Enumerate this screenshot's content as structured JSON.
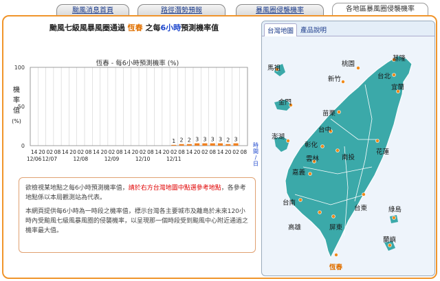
{
  "tabs": [
    {
      "label": "颱風消息首頁",
      "active": false
    },
    {
      "label": "路徑潛勢預報",
      "active": false
    },
    {
      "label": "暴風圈侵襲機率",
      "active": false
    },
    {
      "label": "各地區暴風圈侵襲機率",
      "active": true
    }
  ],
  "chart": {
    "title_prefix": "颱風七級風暴風圈通過",
    "title_station": "恆春",
    "title_mid": "之每",
    "title_hours": "6小時",
    "title_suffix": "預測機率值",
    "subtitle": "恆春 - 每6小時預測機率 (%)",
    "ylabel_chars": [
      "機",
      "率",
      "值",
      "(%)"
    ],
    "xunit_chars": [
      "時",
      "間",
      "/",
      "日"
    ]
  },
  "chart_data": {
    "type": "bar",
    "ylim": [
      0,
      100
    ],
    "yticks": [
      0,
      50,
      100
    ],
    "hour_labels": [
      "14",
      "20",
      "02",
      "08",
      "14",
      "20",
      "02",
      "08",
      "14",
      "20",
      "02",
      "08",
      "14",
      "20",
      "02",
      "08",
      "14",
      "20",
      "02",
      "08",
      "14",
      "20",
      "02",
      "08",
      "14",
      "20",
      "02",
      "08"
    ],
    "date_labels": [
      {
        "label": "12/06",
        "index": 0
      },
      {
        "label": "12/07",
        "index": 2
      },
      {
        "label": "12/08",
        "index": 6
      },
      {
        "label": "12/09",
        "index": 10
      },
      {
        "label": "12/10",
        "index": 14
      },
      {
        "label": "12/11",
        "index": 18
      }
    ],
    "values": [
      null,
      null,
      null,
      null,
      null,
      null,
      null,
      null,
      null,
      null,
      null,
      null,
      null,
      null,
      null,
      null,
      null,
      null,
      1,
      2,
      2,
      3,
      3,
      3,
      3,
      2,
      3,
      null
    ],
    "bar_color": "#f08020",
    "grid_color": "#cfcfcf"
  },
  "info": {
    "p1_a": "欲檢視某地點之每6小時預測機率值，",
    "p1_red": "請於右方台灣地圖中點選參考地點",
    "p1_b": "，各參考地點係以本局觀測站為代表。",
    "p2": "本網頁提供每6小時為一時段之機率值，標示台灣各主要城市及離島於未來120小時內受颱風七級風暴風圈的侵襲機率，以呈現那一個時段受到颱風中心附近通過之機率最大值。"
  },
  "map_tabs": [
    {
      "label": "台灣地圖",
      "active": true
    },
    {
      "label": "產品說明",
      "active": false
    }
  ],
  "stations": [
    {
      "name": "基隆",
      "highlight": false
    },
    {
      "name": "馬祖",
      "highlight": false
    },
    {
      "name": "桃園",
      "highlight": false
    },
    {
      "name": "台北",
      "highlight": false
    },
    {
      "name": "新竹",
      "highlight": false
    },
    {
      "name": "宜蘭",
      "highlight": false
    },
    {
      "name": "金門",
      "highlight": false
    },
    {
      "name": "苗栗",
      "highlight": false
    },
    {
      "name": "台中",
      "highlight": false
    },
    {
      "name": "澎湖",
      "highlight": false
    },
    {
      "name": "彰化",
      "highlight": false
    },
    {
      "name": "花蓮",
      "highlight": false
    },
    {
      "name": "南投",
      "highlight": false
    },
    {
      "name": "雲林",
      "highlight": false
    },
    {
      "name": "嘉義",
      "highlight": false
    },
    {
      "name": "台南",
      "highlight": false
    },
    {
      "name": "台東",
      "highlight": false
    },
    {
      "name": "綠島",
      "highlight": false
    },
    {
      "name": "高雄",
      "highlight": false
    },
    {
      "name": "屏東",
      "highlight": false
    },
    {
      "name": "蘭嶼",
      "highlight": false
    },
    {
      "name": "恆春",
      "highlight": true
    }
  ],
  "colors": {
    "accent": "#f0942a",
    "station_dot": "#f08a1a",
    "land": "#3ba9a9",
    "highlight": "#e07000"
  }
}
